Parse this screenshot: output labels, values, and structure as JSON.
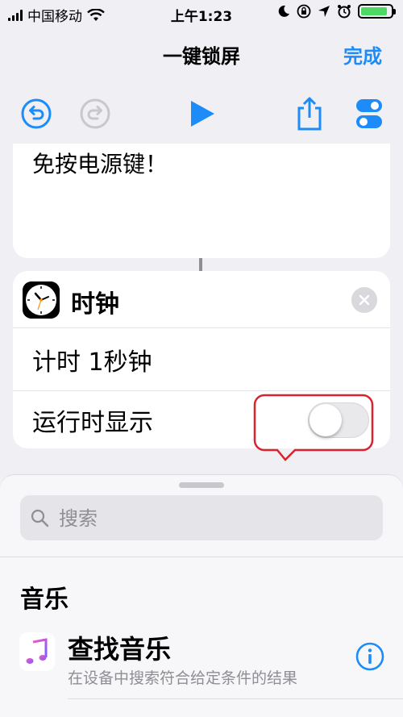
{
  "status_bar": {
    "carrier": "中国移动",
    "time": "上午1:23"
  },
  "nav": {
    "title": "一键锁屏",
    "done_label": "完成"
  },
  "text_action": {
    "text": "免按电源键！"
  },
  "clock_action": {
    "title": "时钟",
    "timer_label": "计时 1秒钟",
    "show_when_run_label": "运行时显示",
    "show_when_run_on": false
  },
  "sheet": {
    "search_placeholder": "搜索",
    "section_title": "音乐",
    "items": [
      {
        "title": "查找音乐",
        "description": "在设备中搜索符合给定条件的结果"
      }
    ]
  },
  "colors": {
    "accent": "#1d8cf8",
    "highlight": "#d9232f",
    "battery": "#4cd964"
  },
  "icons": [
    "undo-icon",
    "redo-icon",
    "play-icon",
    "share-icon",
    "settings-icon",
    "clock-app-icon",
    "close-icon",
    "search-icon",
    "music-icon",
    "info-icon"
  ]
}
